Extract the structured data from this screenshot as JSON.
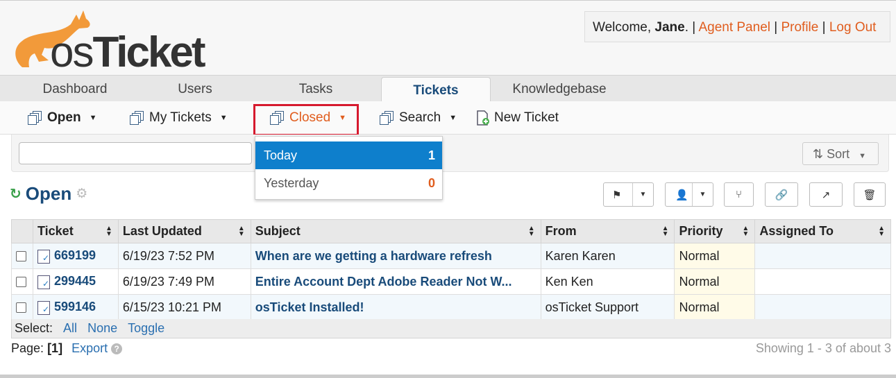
{
  "header": {
    "logo_text_os": "os",
    "logo_text_ticket": "Ticket",
    "welcome_prefix": "Welcome, ",
    "user_name": "Jane",
    "links": [
      "Agent Panel",
      "Profile",
      "Log Out"
    ]
  },
  "tabs": [
    "Dashboard",
    "Users",
    "Tasks",
    "Tickets",
    "Knowledgebase"
  ],
  "active_tab": "Tickets",
  "subnav": {
    "open": "Open",
    "my_tickets": "My Tickets",
    "closed": "Closed",
    "search": "Search",
    "new_ticket": "New Ticket"
  },
  "dropdown": {
    "items": [
      {
        "label": "Today",
        "count": "1"
      },
      {
        "label": "Yesterday",
        "count": "0"
      }
    ]
  },
  "sort_label": "Sort",
  "page_title": "Open",
  "table": {
    "headers": [
      "Ticket",
      "Last Updated",
      "Subject",
      "From",
      "Priority",
      "Assigned To"
    ],
    "rows": [
      {
        "ticket": "669199",
        "updated": "6/19/23 7:52 PM",
        "subject": "When are we getting a hardware refresh",
        "from": "Karen Karen",
        "priority": "Normal",
        "assigned": ""
      },
      {
        "ticket": "299445",
        "updated": "6/19/23 7:49 PM",
        "subject": "Entire Account Dept Adobe Reader Not W...",
        "from": "Ken Ken",
        "priority": "Normal",
        "assigned": ""
      },
      {
        "ticket": "599146",
        "updated": "6/15/23 10:21 PM",
        "subject": "osTicket Installed!",
        "from": "osTicket Support",
        "priority": "Normal",
        "assigned": ""
      }
    ]
  },
  "select": {
    "label": "Select:",
    "all": "All",
    "none": "None",
    "toggle": "Toggle"
  },
  "footer": {
    "page_label": "Page:",
    "page_current": "[1]",
    "export": "Export",
    "showing": "Showing 1 - 3 of about 3"
  },
  "colors": {
    "accent_orange": "#e05d1e",
    "link_blue": "#194b7a",
    "highlight_red": "#d6192e",
    "selected_blue": "#0e7fcc"
  }
}
